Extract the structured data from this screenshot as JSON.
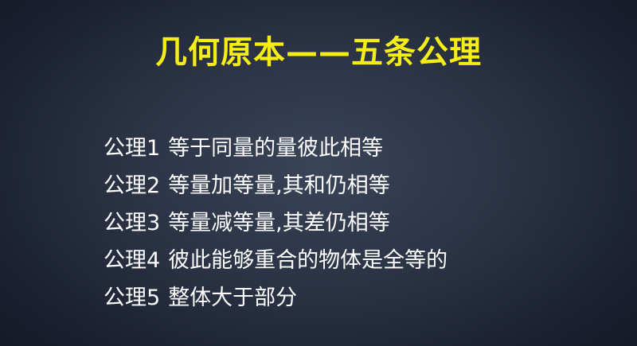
{
  "title": "几何原本——五条公理",
  "axioms": [
    {
      "label": "公理1",
      "text": "等于同量的量彼此相等"
    },
    {
      "label": "公理2",
      "text": "等量加等量,其和仍相等"
    },
    {
      "label": "公理3",
      "text": "等量减等量,其差仍相等"
    },
    {
      "label": "公理4",
      "text": "彼此能够重合的物体是全等的"
    },
    {
      "label": "公理5",
      "text": "整体大于部分"
    }
  ],
  "colors": {
    "title": "#f5ee16",
    "text": "#ffffff",
    "background": "#2a3244"
  }
}
